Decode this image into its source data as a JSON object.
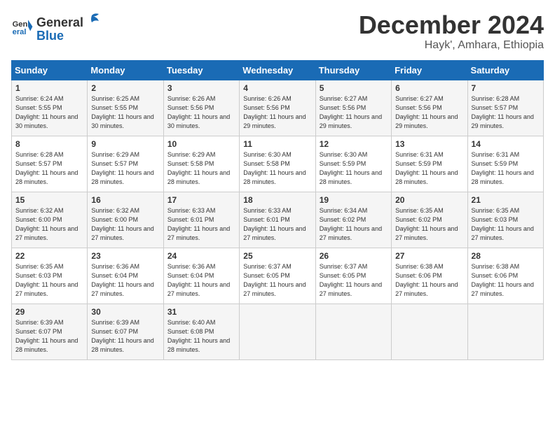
{
  "logo": {
    "line1": "General",
    "line2": "Blue"
  },
  "title": "December 2024",
  "subtitle": "Hayk', Amhara, Ethiopia",
  "days_header": [
    "Sunday",
    "Monday",
    "Tuesday",
    "Wednesday",
    "Thursday",
    "Friday",
    "Saturday"
  ],
  "weeks": [
    [
      {
        "num": "1",
        "rise": "6:24 AM",
        "set": "5:55 PM",
        "daylight": "11 hours and 30 minutes."
      },
      {
        "num": "2",
        "rise": "6:25 AM",
        "set": "5:55 PM",
        "daylight": "11 hours and 30 minutes."
      },
      {
        "num": "3",
        "rise": "6:26 AM",
        "set": "5:56 PM",
        "daylight": "11 hours and 30 minutes."
      },
      {
        "num": "4",
        "rise": "6:26 AM",
        "set": "5:56 PM",
        "daylight": "11 hours and 29 minutes."
      },
      {
        "num": "5",
        "rise": "6:27 AM",
        "set": "5:56 PM",
        "daylight": "11 hours and 29 minutes."
      },
      {
        "num": "6",
        "rise": "6:27 AM",
        "set": "5:56 PM",
        "daylight": "11 hours and 29 minutes."
      },
      {
        "num": "7",
        "rise": "6:28 AM",
        "set": "5:57 PM",
        "daylight": "11 hours and 29 minutes."
      }
    ],
    [
      {
        "num": "8",
        "rise": "6:28 AM",
        "set": "5:57 PM",
        "daylight": "11 hours and 28 minutes."
      },
      {
        "num": "9",
        "rise": "6:29 AM",
        "set": "5:57 PM",
        "daylight": "11 hours and 28 minutes."
      },
      {
        "num": "10",
        "rise": "6:29 AM",
        "set": "5:58 PM",
        "daylight": "11 hours and 28 minutes."
      },
      {
        "num": "11",
        "rise": "6:30 AM",
        "set": "5:58 PM",
        "daylight": "11 hours and 28 minutes."
      },
      {
        "num": "12",
        "rise": "6:30 AM",
        "set": "5:59 PM",
        "daylight": "11 hours and 28 minutes."
      },
      {
        "num": "13",
        "rise": "6:31 AM",
        "set": "5:59 PM",
        "daylight": "11 hours and 28 minutes."
      },
      {
        "num": "14",
        "rise": "6:31 AM",
        "set": "5:59 PM",
        "daylight": "11 hours and 28 minutes."
      }
    ],
    [
      {
        "num": "15",
        "rise": "6:32 AM",
        "set": "6:00 PM",
        "daylight": "11 hours and 27 minutes."
      },
      {
        "num": "16",
        "rise": "6:32 AM",
        "set": "6:00 PM",
        "daylight": "11 hours and 27 minutes."
      },
      {
        "num": "17",
        "rise": "6:33 AM",
        "set": "6:01 PM",
        "daylight": "11 hours and 27 minutes."
      },
      {
        "num": "18",
        "rise": "6:33 AM",
        "set": "6:01 PM",
        "daylight": "11 hours and 27 minutes."
      },
      {
        "num": "19",
        "rise": "6:34 AM",
        "set": "6:02 PM",
        "daylight": "11 hours and 27 minutes."
      },
      {
        "num": "20",
        "rise": "6:35 AM",
        "set": "6:02 PM",
        "daylight": "11 hours and 27 minutes."
      },
      {
        "num": "21",
        "rise": "6:35 AM",
        "set": "6:03 PM",
        "daylight": "11 hours and 27 minutes."
      }
    ],
    [
      {
        "num": "22",
        "rise": "6:35 AM",
        "set": "6:03 PM",
        "daylight": "11 hours and 27 minutes."
      },
      {
        "num": "23",
        "rise": "6:36 AM",
        "set": "6:04 PM",
        "daylight": "11 hours and 27 minutes."
      },
      {
        "num": "24",
        "rise": "6:36 AM",
        "set": "6:04 PM",
        "daylight": "11 hours and 27 minutes."
      },
      {
        "num": "25",
        "rise": "6:37 AM",
        "set": "6:05 PM",
        "daylight": "11 hours and 27 minutes."
      },
      {
        "num": "26",
        "rise": "6:37 AM",
        "set": "6:05 PM",
        "daylight": "11 hours and 27 minutes."
      },
      {
        "num": "27",
        "rise": "6:38 AM",
        "set": "6:06 PM",
        "daylight": "11 hours and 27 minutes."
      },
      {
        "num": "28",
        "rise": "6:38 AM",
        "set": "6:06 PM",
        "daylight": "11 hours and 27 minutes."
      }
    ],
    [
      {
        "num": "29",
        "rise": "6:39 AM",
        "set": "6:07 PM",
        "daylight": "11 hours and 28 minutes."
      },
      {
        "num": "30",
        "rise": "6:39 AM",
        "set": "6:07 PM",
        "daylight": "11 hours and 28 minutes."
      },
      {
        "num": "31",
        "rise": "6:40 AM",
        "set": "6:08 PM",
        "daylight": "11 hours and 28 minutes."
      },
      null,
      null,
      null,
      null
    ]
  ],
  "labels": {
    "sunrise": "Sunrise:",
    "sunset": "Sunset:",
    "daylight": "Daylight:"
  }
}
